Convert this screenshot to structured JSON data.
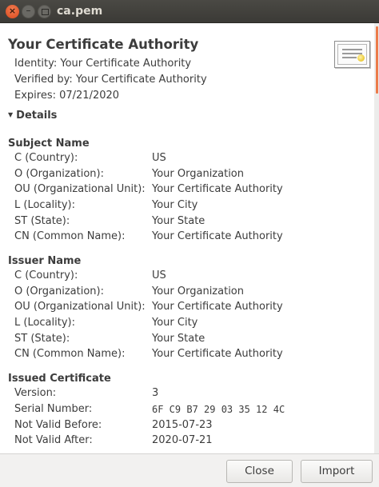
{
  "window": {
    "title": "ca.pem"
  },
  "certificate": {
    "title": "Your Certificate Authority",
    "identity": "Identity: Your Certificate Authority",
    "verified_by": "Verified by: Your Certificate Authority",
    "expires": "Expires: 07/21/2020"
  },
  "details": {
    "toggle_label": "Details"
  },
  "subject": {
    "heading": "Subject Name",
    "rows": [
      {
        "key": "C (Country):",
        "value": "US"
      },
      {
        "key": "O (Organization):",
        "value": "Your Organization"
      },
      {
        "key": "OU (Organizational Unit):",
        "value": "Your Certificate Authority"
      },
      {
        "key": "L (Locality):",
        "value": "Your City"
      },
      {
        "key": "ST (State):",
        "value": "Your State"
      },
      {
        "key": "CN (Common Name):",
        "value": "Your Certificate Authority"
      }
    ]
  },
  "issuer": {
    "heading": "Issuer Name",
    "rows": [
      {
        "key": "C (Country):",
        "value": "US"
      },
      {
        "key": "O (Organization):",
        "value": "Your Organization"
      },
      {
        "key": "OU (Organizational Unit):",
        "value": "Your Certificate Authority"
      },
      {
        "key": "L (Locality):",
        "value": "Your City"
      },
      {
        "key": "ST (State):",
        "value": "Your State"
      },
      {
        "key": "CN (Common Name):",
        "value": "Your Certificate Authority"
      }
    ]
  },
  "issued": {
    "heading": "Issued Certificate",
    "rows": [
      {
        "key": "Version:",
        "value": "3"
      },
      {
        "key": "Serial Number:",
        "value": "6F C9 B7 29 03 35 12 4C"
      },
      {
        "key": "Not Valid Before:",
        "value": "2015-07-23"
      },
      {
        "key": "Not Valid After:",
        "value": "2020-07-21"
      }
    ]
  },
  "buttons": {
    "close": "Close",
    "import": "Import"
  },
  "colors": {
    "accent": "#ec7b4a",
    "titlebar": "#3b3a36",
    "close_button": "#e05a2b"
  },
  "icons": {
    "window_close": "close-icon",
    "window_minimize": "minimize-icon",
    "window_maximize": "maximize-icon",
    "certificate": "certificate-icon",
    "details_toggle": "triangle-down-icon"
  }
}
